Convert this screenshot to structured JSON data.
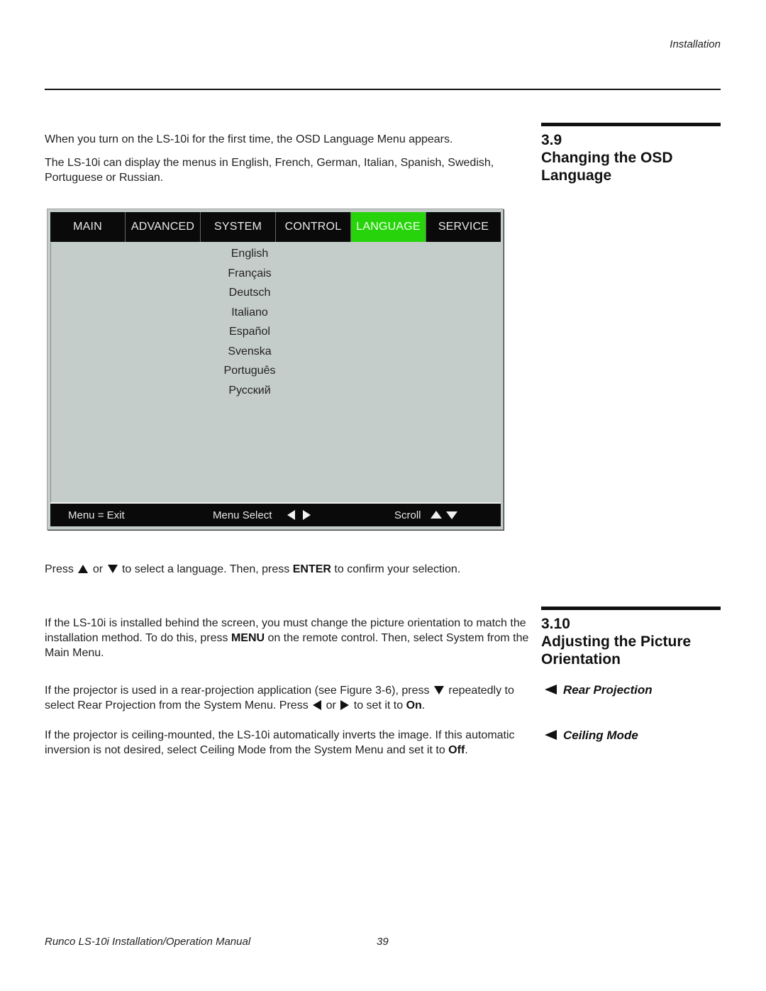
{
  "header": {
    "running_head": "Installation"
  },
  "section_39": {
    "number": "3.9",
    "title_line1": "Changing the OSD",
    "title_line2": "Language",
    "intro": "When you turn on the LS-10i for the first time, the OSD Language Menu appears.",
    "languages_text": "The LS-10i can display the menus in English, French, German, Italian, Spanish, Swedish, Portuguese or Russian.",
    "instruction": {
      "press": "Press",
      "or": "or",
      "rest": "to select a language. Then, press",
      "enter": "ENTER",
      "end": "to confirm your selection."
    }
  },
  "osd": {
    "tabs": [
      {
        "label": "MAIN",
        "active": false
      },
      {
        "label": "ADVANCED",
        "active": false
      },
      {
        "label": "SYSTEM",
        "active": false
      },
      {
        "label": "CONTROL",
        "active": false
      },
      {
        "label": "LANGUAGE",
        "active": true
      },
      {
        "label": "SERVICE",
        "active": false
      }
    ],
    "active_color": "#27d40b",
    "languages": [
      "English",
      "Français",
      "Deutsch",
      "Italiano",
      "Español",
      "Svenska",
      "Português",
      "Русский"
    ],
    "footer": {
      "exit": "Menu = Exit",
      "select": "Menu Select",
      "scroll": "Scroll",
      "select_icons": [
        "arrow-left-icon",
        "arrow-right-icon"
      ],
      "scroll_icons": [
        "arrow-up-icon",
        "arrow-down-icon"
      ]
    }
  },
  "section_310": {
    "number": "3.10",
    "title_line1": "Adjusting the Picture",
    "title_line2": "Orientation",
    "intro": {
      "a": "If the LS-10i is installed behind the screen, you must change the picture orientation to match the installation method. To do this, press",
      "menu": "MENU",
      "b": "on the remote control. Then, select System from the Main Menu."
    },
    "rear": {
      "label": "Rear Projection",
      "a": "If the projector is used in a rear-projection application (see Figure 3-6), press",
      "b": "repeatedly to select Rear Projection from the System Menu. Press",
      "or": "or",
      "c": "to set it to",
      "on": "On",
      "end": "."
    },
    "ceiling": {
      "label": "Ceiling Mode",
      "a": "If the projector is ceiling-mounted, the LS-10i automatically inverts the image.  If this automatic inversion is not desired, select Ceiling Mode from the System Menu and set it to",
      "off": "Off",
      "end": "."
    }
  },
  "footer": {
    "manual": "Runco LS-10i Installation/Operation Manual",
    "page": "39"
  }
}
